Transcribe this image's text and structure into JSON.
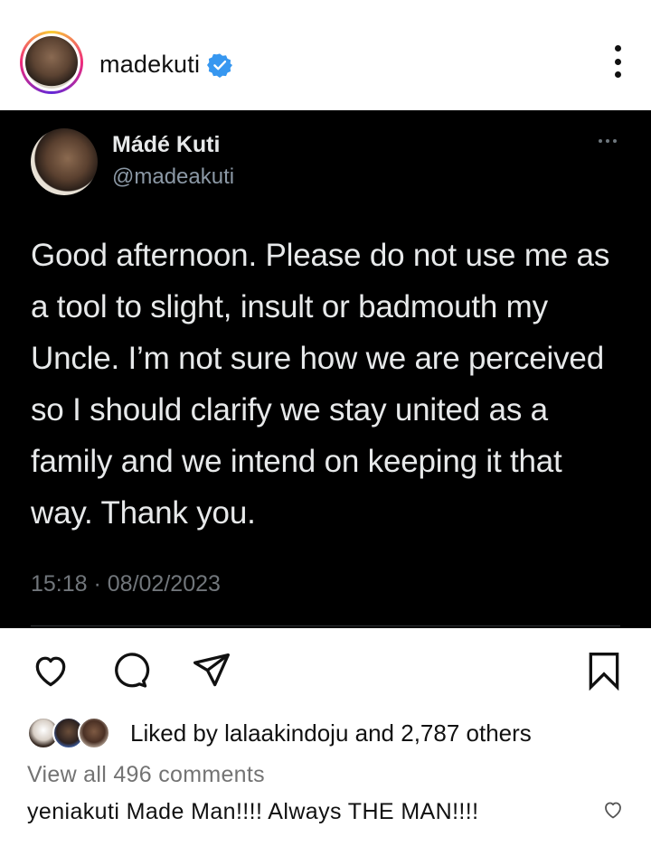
{
  "post": {
    "username": "madekuti",
    "verified": true
  },
  "tweet": {
    "display_name": "Mádé Kuti",
    "handle": "@madeakuti",
    "text": "Good afternoon. Please do not use me as a tool to slight, insult or badmouth my Uncle. I’m not sure how we are perceived so I should clarify we stay united as a family and we intend on keeping it that way. Thank you.",
    "timestamp": "15:18 · 08/02/2023"
  },
  "likes": {
    "prefix": "Liked by ",
    "user": "lalaakindoju",
    "middle": " and ",
    "count": "2,787 others"
  },
  "comments": {
    "view_all": "View all 496 comments",
    "first": {
      "user": "yeniakuti",
      "text": "Made Man!!!! Always THE MAN!!!!"
    }
  },
  "icons": [
    "verified-badge-icon",
    "more-options-icon",
    "heart-icon",
    "comment-icon",
    "share-icon",
    "bookmark-icon"
  ],
  "colors": {
    "verified": "#3797f0",
    "tweet_bg": "#000000",
    "muted": "#737373"
  }
}
